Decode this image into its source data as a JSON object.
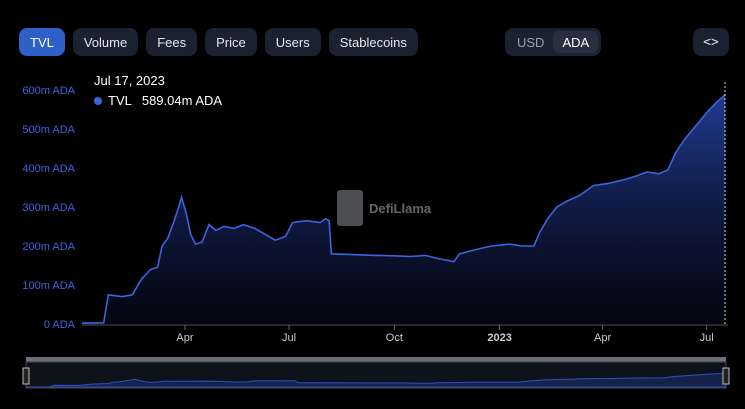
{
  "tabs": [
    {
      "label": "TVL",
      "active": true
    },
    {
      "label": "Volume",
      "active": false
    },
    {
      "label": "Fees",
      "active": false
    },
    {
      "label": "Price",
      "active": false
    },
    {
      "label": "Users",
      "active": false
    },
    {
      "label": "Stablecoins",
      "active": false
    }
  ],
  "currency": [
    {
      "label": "USD",
      "active": false
    },
    {
      "label": "ADA",
      "active": true
    }
  ],
  "embed_icon": "code-icon",
  "tooltip": {
    "date": "Jul 17, 2023",
    "series": "TVL",
    "value": "589.04m ADA"
  },
  "watermark": "DefiLlama",
  "colors": {
    "line": "#3d63e0",
    "tab_active": "#2f60c7",
    "axis_text": "#3d63e0"
  },
  "chart_data": {
    "type": "area",
    "ylim": [
      0,
      600
    ],
    "y_ticks": [
      "0 ADA",
      "100m ADA",
      "200m ADA",
      "300m ADA",
      "400m ADA",
      "500m ADA",
      "600m ADA"
    ],
    "x_ticks": [
      "Apr",
      "Jul",
      "Oct",
      "2023",
      "Apr",
      "Jul"
    ],
    "xlabel": "",
    "ylabel": "",
    "series": [
      {
        "name": "TVL",
        "unit": "m ADA",
        "points": [
          [
            "2022-01-01",
            2
          ],
          [
            "2022-01-20",
            3
          ],
          [
            "2022-01-24",
            75
          ],
          [
            "2022-02-05",
            70
          ],
          [
            "2022-02-14",
            75
          ],
          [
            "2022-02-22",
            115
          ],
          [
            "2022-03-02",
            140
          ],
          [
            "2022-03-08",
            145
          ],
          [
            "2022-03-12",
            200
          ],
          [
            "2022-03-17",
            220
          ],
          [
            "2022-03-22",
            260
          ],
          [
            "2022-03-27",
            305
          ],
          [
            "2022-03-29",
            325
          ],
          [
            "2022-04-02",
            285
          ],
          [
            "2022-04-06",
            230
          ],
          [
            "2022-04-10",
            205
          ],
          [
            "2022-04-16",
            210
          ],
          [
            "2022-04-22",
            255
          ],
          [
            "2022-04-28",
            240
          ],
          [
            "2022-05-05",
            250
          ],
          [
            "2022-05-14",
            245
          ],
          [
            "2022-05-22",
            255
          ],
          [
            "2022-06-01",
            245
          ],
          [
            "2022-06-10",
            230
          ],
          [
            "2022-06-19",
            215
          ],
          [
            "2022-06-28",
            225
          ],
          [
            "2022-07-04",
            260
          ],
          [
            "2022-07-16",
            265
          ],
          [
            "2022-07-28",
            260
          ],
          [
            "2022-08-02",
            270
          ],
          [
            "2022-08-05",
            265
          ],
          [
            "2022-08-07",
            180
          ],
          [
            "2022-08-25",
            178
          ],
          [
            "2022-09-15",
            176
          ],
          [
            "2022-10-01",
            175
          ],
          [
            "2022-10-15",
            173
          ],
          [
            "2022-10-28",
            176
          ],
          [
            "2022-11-08",
            168
          ],
          [
            "2022-11-22",
            160
          ],
          [
            "2022-11-27",
            180
          ],
          [
            "2022-12-10",
            190
          ],
          [
            "2022-12-25",
            200
          ],
          [
            "2023-01-10",
            205
          ],
          [
            "2023-01-20",
            200
          ],
          [
            "2023-01-31",
            200
          ],
          [
            "2023-02-05",
            235
          ],
          [
            "2023-02-12",
            270
          ],
          [
            "2023-02-20",
            300
          ],
          [
            "2023-03-01",
            315
          ],
          [
            "2023-03-12",
            330
          ],
          [
            "2023-03-24",
            355
          ],
          [
            "2023-04-05",
            360
          ],
          [
            "2023-04-20",
            370
          ],
          [
            "2023-05-01",
            380
          ],
          [
            "2023-05-10",
            390
          ],
          [
            "2023-05-20",
            385
          ],
          [
            "2023-05-28",
            395
          ],
          [
            "2023-06-04",
            440
          ],
          [
            "2023-06-12",
            475
          ],
          [
            "2023-06-22",
            510
          ],
          [
            "2023-07-02",
            545
          ],
          [
            "2023-07-10",
            570
          ],
          [
            "2023-07-15",
            582
          ],
          [
            "2023-07-17",
            589
          ]
        ]
      }
    ]
  }
}
